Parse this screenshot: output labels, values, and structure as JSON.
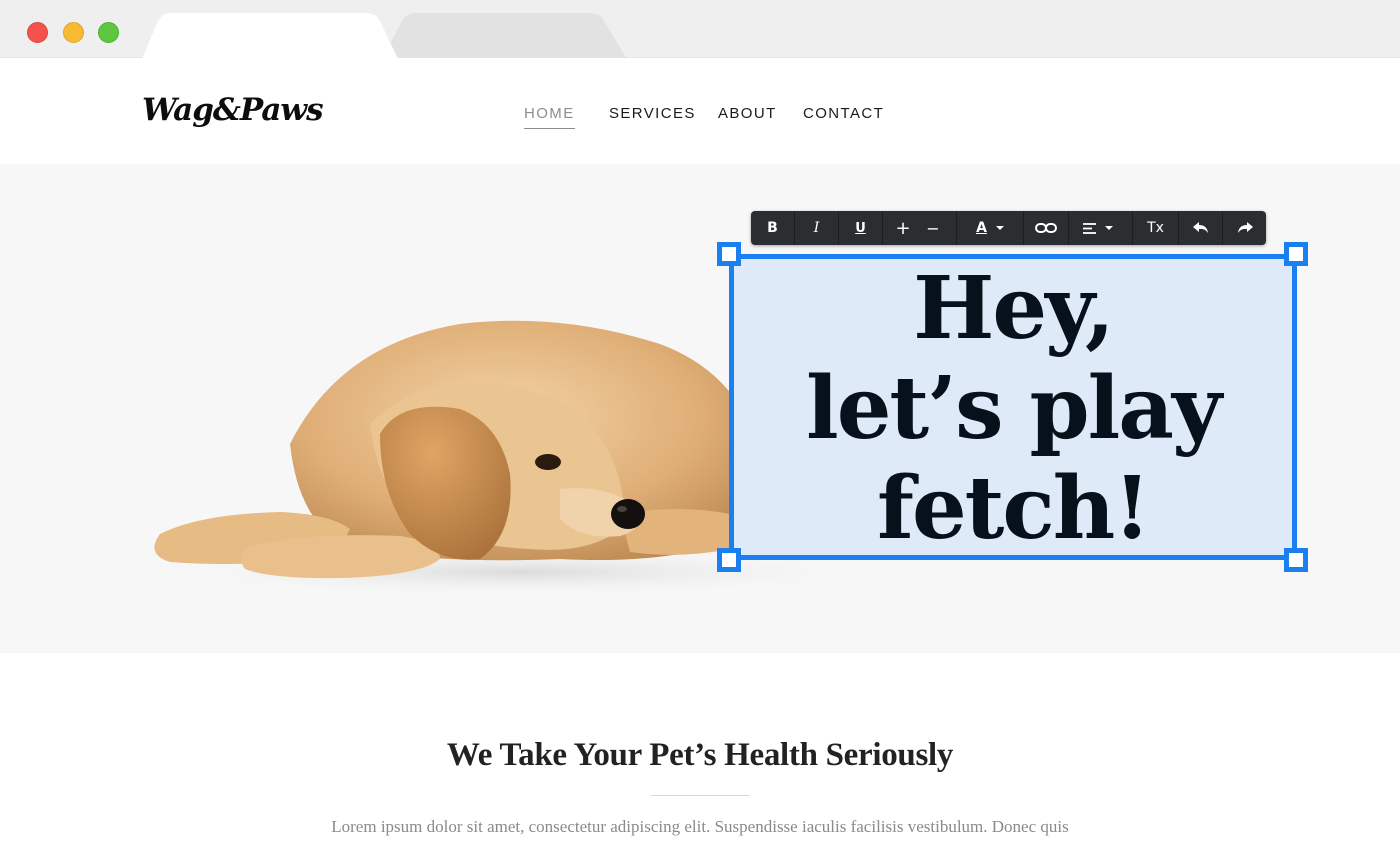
{
  "site": {
    "logo": "Wag&Paws",
    "nav": [
      {
        "label": "HOME",
        "active": true
      },
      {
        "label": "SERVICES",
        "active": false
      },
      {
        "label": "ABOUT",
        "active": false
      },
      {
        "label": "CONTACT",
        "active": false
      }
    ]
  },
  "editor_toolbar": {
    "bold": "B",
    "italic": "I",
    "underline": "U",
    "increase_size": "+",
    "decrease_size": "−",
    "text_color": "A",
    "clear_format": "Tx"
  },
  "hero": {
    "headline_lines": [
      "Hey,",
      "let’s play",
      "fetch!"
    ],
    "selection_color": "#1a80f0"
  },
  "section": {
    "title": "We Take Your Pet’s Health Seriously",
    "body": "Lorem ipsum dolor sit amet, consectetur adipiscing elit. Suspendisse iaculis facilisis vestibulum. Donec quis"
  }
}
